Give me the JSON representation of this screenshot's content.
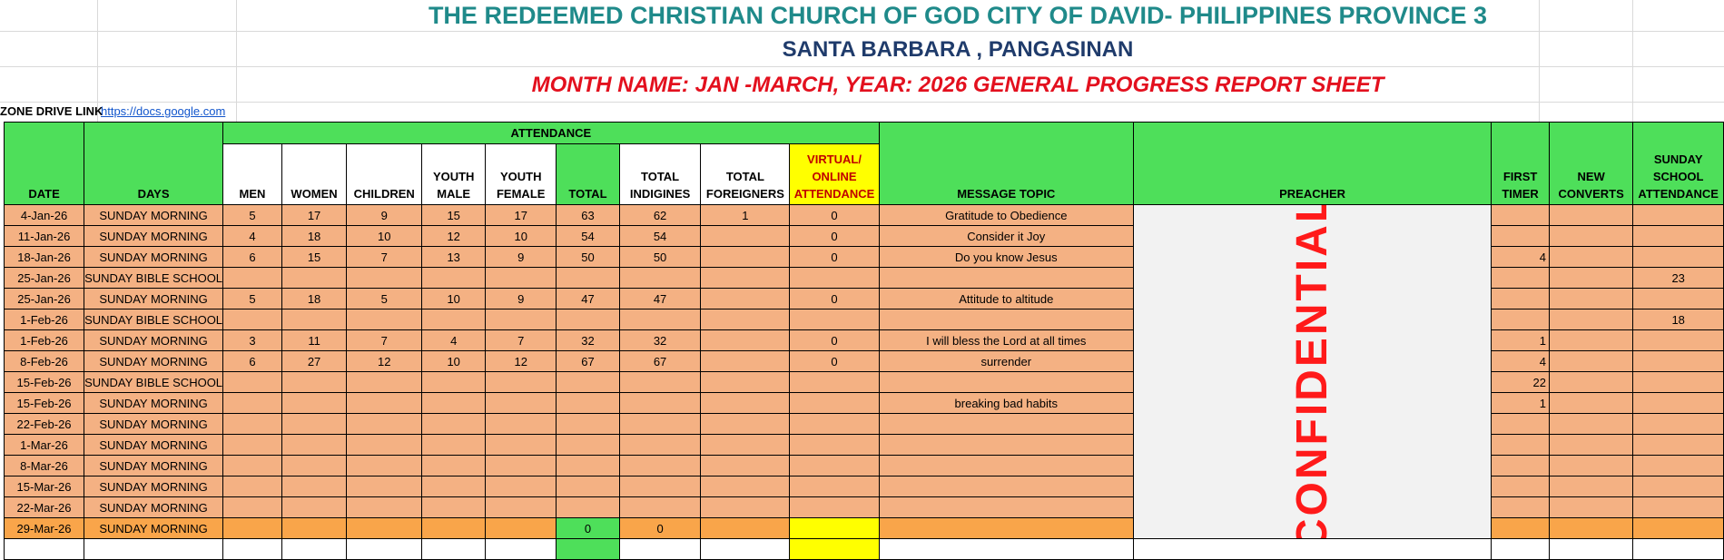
{
  "title": "THE REDEEMED CHRISTIAN CHURCH OF GOD CITY OF DAVID- PHILIPPINES PROVINCE 3",
  "subtitle": "SANTA BARBARA , PANGASINAN",
  "report_title": "MONTH NAME:  JAN -MARCH, YEAR: 2026 GENERAL PROGRESS REPORT SHEET",
  "zone_label": "ZONE DRIVE LINK",
  "zone_link": "https://docs.google.com",
  "headers": {
    "attendance": "ATTENDANCE",
    "date": "DATE",
    "days": "DAYS",
    "men": "MEN",
    "women": "WOMEN",
    "children": "CHILDREN",
    "youth_male": "YOUTH MALE",
    "youth_female": "YOUTH FEMALE",
    "total": "TOTAL",
    "total_indigines": "TOTAL INDIGINES",
    "total_foreigners": "TOTAL FOREIGNERS",
    "virtual": "VIRTUAL/ ONLINE ATTENDANCE",
    "message_topic": "MESSAGE TOPIC",
    "preacher": "PREACHER",
    "first_timer": "FIRST TIMER",
    "new_converts": "NEW CONVERTS",
    "sunday_school": "SUNDAY SCHOOL ATTENDANCE"
  },
  "confidential": "CONFIDENTIAL",
  "rows": [
    {
      "date": "4-Jan-26",
      "day": "SUNDAY MORNING",
      "men": "5",
      "women": "17",
      "children": "9",
      "ym": "15",
      "yf": "17",
      "total": "63",
      "ind": "62",
      "for": "1",
      "virt": "0",
      "topic": "Gratitude to Obedience",
      "ft": "",
      "nc": "",
      "ss": ""
    },
    {
      "date": "11-Jan-26",
      "day": "SUNDAY MORNING",
      "men": "4",
      "women": "18",
      "children": "10",
      "ym": "12",
      "yf": "10",
      "total": "54",
      "ind": "54",
      "for": "",
      "virt": "0",
      "topic": "Consider it Joy",
      "ft": "",
      "nc": "",
      "ss": ""
    },
    {
      "date": "18-Jan-26",
      "day": "SUNDAY MORNING",
      "men": "6",
      "women": "15",
      "children": "7",
      "ym": "13",
      "yf": "9",
      "total": "50",
      "ind": "50",
      "for": "",
      "virt": "0",
      "topic": "Do you know Jesus",
      "ft": "4",
      "nc": "",
      "ss": ""
    },
    {
      "date": "25-Jan-26",
      "day": "SUNDAY BIBLE SCHOOL",
      "men": "",
      "women": "",
      "children": "",
      "ym": "",
      "yf": "",
      "total": "",
      "ind": "",
      "for": "",
      "virt": "",
      "topic": "",
      "ft": "",
      "nc": "",
      "ss": "23"
    },
    {
      "date": "25-Jan-26",
      "day": "SUNDAY MORNING",
      "men": "5",
      "women": "18",
      "children": "5",
      "ym": "10",
      "yf": "9",
      "total": "47",
      "ind": "47",
      "for": "",
      "virt": "0",
      "topic": "Attitude to altitude",
      "ft": "",
      "nc": "",
      "ss": ""
    },
    {
      "date": "1-Feb-26",
      "day": "SUNDAY BIBLE SCHOOL",
      "men": "",
      "women": "",
      "children": "",
      "ym": "",
      "yf": "",
      "total": "",
      "ind": "",
      "for": "",
      "virt": "",
      "topic": "",
      "ft": "",
      "nc": "",
      "ss": "18"
    },
    {
      "date": "1-Feb-26",
      "day": "SUNDAY MORNING",
      "men": "3",
      "women": "11",
      "children": "7",
      "ym": "4",
      "yf": "7",
      "total": "32",
      "ind": "32",
      "for": "",
      "virt": "0",
      "topic": "I will bless the Lord at all times",
      "ft": "1",
      "nc": "",
      "ss": ""
    },
    {
      "date": "8-Feb-26",
      "day": "SUNDAY MORNING",
      "men": "6",
      "women": "27",
      "children": "12",
      "ym": "10",
      "yf": "12",
      "total": "67",
      "ind": "67",
      "for": "",
      "virt": "0",
      "topic": "surrender",
      "ft": "4",
      "nc": "",
      "ss": ""
    },
    {
      "date": "15-Feb-26",
      "day": "SUNDAY BIBLE SCHOOL",
      "men": "",
      "women": "",
      "children": "",
      "ym": "",
      "yf": "",
      "total": "",
      "ind": "",
      "for": "",
      "virt": "",
      "topic": "",
      "ft": "22",
      "nc": "",
      "ss": ""
    },
    {
      "date": "15-Feb-26",
      "day": "SUNDAY MORNING",
      "men": "",
      "women": "",
      "children": "",
      "ym": "",
      "yf": "",
      "total": "",
      "ind": "",
      "for": "",
      "virt": "",
      "topic": "breaking bad habits",
      "ft": "1",
      "nc": "",
      "ss": ""
    },
    {
      "date": "22-Feb-26",
      "day": "SUNDAY MORNING",
      "men": "",
      "women": "",
      "children": "",
      "ym": "",
      "yf": "",
      "total": "",
      "ind": "",
      "for": "",
      "virt": "",
      "topic": "",
      "ft": "",
      "nc": "",
      "ss": ""
    },
    {
      "date": "1-Mar-26",
      "day": "SUNDAY MORNING",
      "men": "",
      "women": "",
      "children": "",
      "ym": "",
      "yf": "",
      "total": "",
      "ind": "",
      "for": "",
      "virt": "",
      "topic": "",
      "ft": "",
      "nc": "",
      "ss": ""
    },
    {
      "date": "8-Mar-26",
      "day": "SUNDAY MORNING",
      "men": "",
      "women": "",
      "children": "",
      "ym": "",
      "yf": "",
      "total": "",
      "ind": "",
      "for": "",
      "virt": "",
      "topic": "",
      "ft": "",
      "nc": "",
      "ss": ""
    },
    {
      "date": "15-Mar-26",
      "day": "SUNDAY MORNING",
      "men": "",
      "women": "",
      "children": "",
      "ym": "",
      "yf": "",
      "total": "",
      "ind": "",
      "for": "",
      "virt": "",
      "topic": "",
      "ft": "",
      "nc": "",
      "ss": ""
    },
    {
      "date": "22-Mar-26",
      "day": "SUNDAY MORNING",
      "men": "",
      "women": "",
      "children": "",
      "ym": "",
      "yf": "",
      "total": "",
      "ind": "",
      "for": "",
      "virt": "",
      "topic": "",
      "ft": "",
      "nc": "",
      "ss": ""
    },
    {
      "date": "29-Mar-26",
      "day": "SUNDAY MORNING",
      "men": "",
      "women": "",
      "children": "",
      "ym": "",
      "yf": "",
      "total": "0",
      "ind": "0",
      "for": "",
      "virt": "",
      "topic": "",
      "ft": "",
      "nc": "",
      "ss": ""
    }
  ],
  "colors": {
    "header_green": "#4edf5a",
    "row_orange": "#f4b183",
    "last_row_orange": "#f9a54a",
    "virtual_yellow": "#ffff00",
    "confidential_red": "#ff1a1a",
    "title_teal": "#1f8a8a",
    "subtitle_navy": "#1f3b6b",
    "report_red": "#e3101e"
  }
}
